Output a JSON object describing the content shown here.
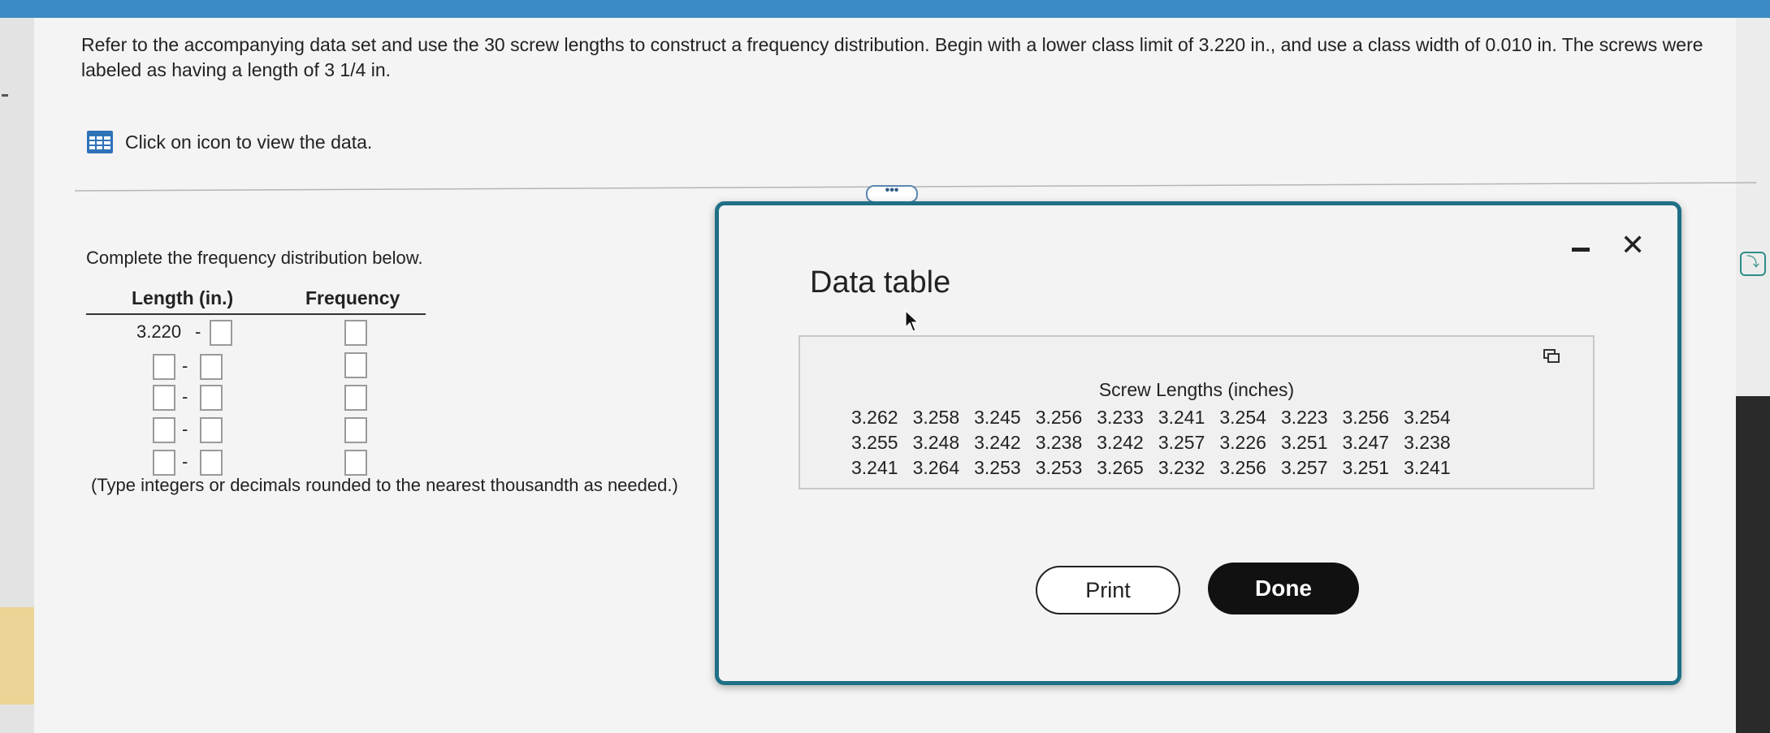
{
  "question": {
    "text": "Refer to the accompanying data set and use the 30 screw lengths to construct a frequency distribution. Begin with a lower class limit of 3.220 in., and use a class width of 0.010 in. The screws were labeled as having a length of 3 1/4 in.",
    "data_link_label": "Click on icon to view the data."
  },
  "frequency_distribution": {
    "instruction": "Complete the frequency distribution below.",
    "col_length": "Length (in.)",
    "col_frequency": "Frequency",
    "first_lower": "3.220",
    "dash": "-",
    "hint": "(Type integers or decimals rounded to the nearest thousandth as needed.)"
  },
  "modal": {
    "title": "Data table",
    "table_caption": "Screw Lengths (inches)",
    "rows": [
      [
        "3.262",
        "3.258",
        "3.245",
        "3.256",
        "3.233",
        "3.241",
        "3.254",
        "3.223",
        "3.256",
        "3.254"
      ],
      [
        "3.255",
        "3.248",
        "3.242",
        "3.238",
        "3.242",
        "3.257",
        "3.226",
        "3.251",
        "3.247",
        "3.238"
      ],
      [
        "3.241",
        "3.264",
        "3.253",
        "3.253",
        "3.265",
        "3.232",
        "3.256",
        "3.257",
        "3.251",
        "3.241"
      ]
    ],
    "print_label": "Print",
    "done_label": "Done",
    "close_glyph": "✕"
  },
  "ellipsis_label": "•••",
  "colors": {
    "accent": "#1f6f86",
    "topbar": "#3b8cc4",
    "done_bg": "#111111"
  },
  "icons": {
    "data": "grid-table-icon",
    "copy": "copy-icon",
    "close": "close-icon",
    "minimize": "minimize-icon",
    "cursor": "mouse-cursor-icon"
  }
}
